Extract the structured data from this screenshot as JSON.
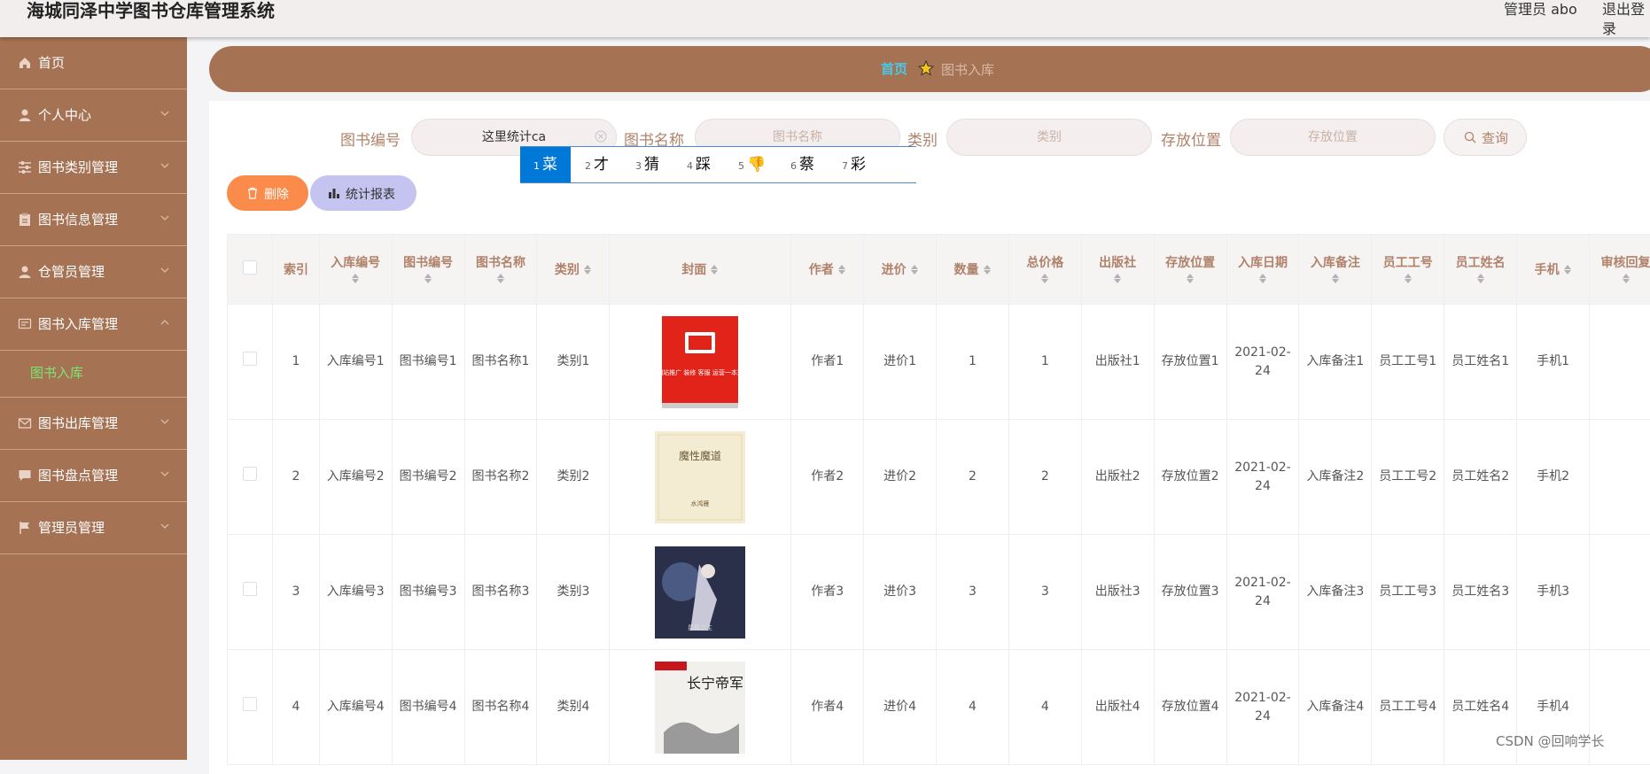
{
  "header": {
    "title": "海城同泽中学图书仓库管理系统",
    "user": "管理员 abo",
    "logout": "退出登录"
  },
  "sidebar": {
    "items": [
      {
        "label": "首页",
        "icon": "home-icon",
        "arrow": false
      },
      {
        "label": "个人中心",
        "icon": "user-icon",
        "arrow": true
      },
      {
        "label": "图书类别管理",
        "icon": "sliders-icon",
        "arrow": true
      },
      {
        "label": "图书信息管理",
        "icon": "clipboard-icon",
        "arrow": true
      },
      {
        "label": "仓管员管理",
        "icon": "user-icon",
        "arrow": true
      },
      {
        "label": "图书入库管理",
        "icon": "message-icon",
        "arrow": true,
        "expanded": true
      },
      {
        "label": "图书出库管理",
        "icon": "mail-icon",
        "arrow": true
      },
      {
        "label": "图书盘点管理",
        "icon": "chat-icon",
        "arrow": true
      },
      {
        "label": "管理员管理",
        "icon": "flag-icon",
        "arrow": true
      }
    ],
    "sub_item": "图书入库"
  },
  "breadcrumb": {
    "home": "首页",
    "current": "图书入库"
  },
  "search": {
    "book_no_label": "图书编号",
    "book_no_value": "这里统计ca",
    "book_name_label": "图书名称",
    "book_name_placeholder": "图书名称",
    "category_label": "类别",
    "category_placeholder": "类别",
    "location_label": "存放位置",
    "location_placeholder": "存放位置",
    "search_button": "查询"
  },
  "ime_candidates": [
    {
      "n": "1",
      "c": "菜"
    },
    {
      "n": "2",
      "c": "才"
    },
    {
      "n": "3",
      "c": "猜"
    },
    {
      "n": "4",
      "c": "踩"
    },
    {
      "n": "5",
      "c": "👎"
    },
    {
      "n": "6",
      "c": "蔡"
    },
    {
      "n": "7",
      "c": "彩"
    }
  ],
  "actions": {
    "delete": "删除",
    "report": "统计报表"
  },
  "table": {
    "headers": [
      "索引",
      "入库编号",
      "图书编号",
      "图书名称",
      "类别",
      "封面",
      "作者",
      "进价",
      "数量",
      "总价格",
      "出版社",
      "存放位置",
      "入库日期",
      "入库备注",
      "员工工号",
      "员工姓名",
      "手机",
      "审核回复"
    ],
    "rows": [
      [
        "1",
        "入库编号1",
        "图书编号1",
        "图书名称1",
        "类别1",
        "",
        "作者1",
        "进价1",
        "1",
        "1",
        "出版社1",
        "存放位置1",
        "2021-02-24",
        "入库备注1",
        "员工工号1",
        "员工姓名1",
        "手机1",
        ""
      ],
      [
        "2",
        "入库编号2",
        "图书编号2",
        "图书名称2",
        "类别2",
        "",
        "作者2",
        "进价2",
        "2",
        "2",
        "出版社2",
        "存放位置2",
        "2021-02-24",
        "入库备注2",
        "员工工号2",
        "员工姓名2",
        "手机2",
        ""
      ],
      [
        "3",
        "入库编号3",
        "图书编号3",
        "图书名称3",
        "类别3",
        "",
        "作者3",
        "进价3",
        "3",
        "3",
        "出版社3",
        "存放位置3",
        "2021-02-24",
        "入库备注3",
        "员工工号3",
        "员工姓名3",
        "手机3",
        ""
      ],
      [
        "4",
        "入库编号4",
        "图书编号4",
        "图书名称4",
        "类别4",
        "",
        "作者4",
        "进价4",
        "4",
        "4",
        "出版社4",
        "存放位置4",
        "2021-02-24",
        "入库备注4",
        "员工工号4",
        "员工姓名4",
        "手机4",
        ""
      ]
    ],
    "covers": [
      {
        "title": "网站推广 装修 客服 运营一本通"
      },
      {
        "title": "魔性魔道",
        "author": "水鸿雁"
      },
      {
        "title": "星极之主"
      },
      {
        "title": "长宁帝军"
      }
    ]
  },
  "colors": {
    "sidebar": "#a57254",
    "accent_link": "#48c9e6",
    "active_sub": "#7ce76f",
    "delete_btn": "#fa8b4b",
    "report_btn": "#c5c3ef"
  },
  "watermark": "CSDN @回响学长"
}
